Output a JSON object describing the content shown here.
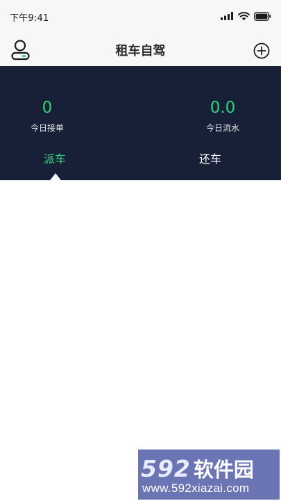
{
  "status_bar": {
    "time": "下午9:41",
    "icons": [
      "signal-icon",
      "wifi-icon",
      "battery-icon"
    ]
  },
  "nav": {
    "title": "租车自驾",
    "left_icon": "user-icon",
    "right_icon": "add-circle-icon"
  },
  "stats": [
    {
      "value": "0",
      "label": "今日接单"
    },
    {
      "value": "0.0",
      "label": "今日流水"
    }
  ],
  "tabs": [
    {
      "label": "派车",
      "active": true
    },
    {
      "label": "还车",
      "active": false
    }
  ],
  "watermark": {
    "number": "592",
    "name": "软件园",
    "url": "www.592xiazai.com"
  },
  "colors": {
    "accent_green": "#2fd27a",
    "panel_navy": "#172036",
    "bar_background": "#f7f7f7",
    "watermark_background": "#6b75b4"
  }
}
